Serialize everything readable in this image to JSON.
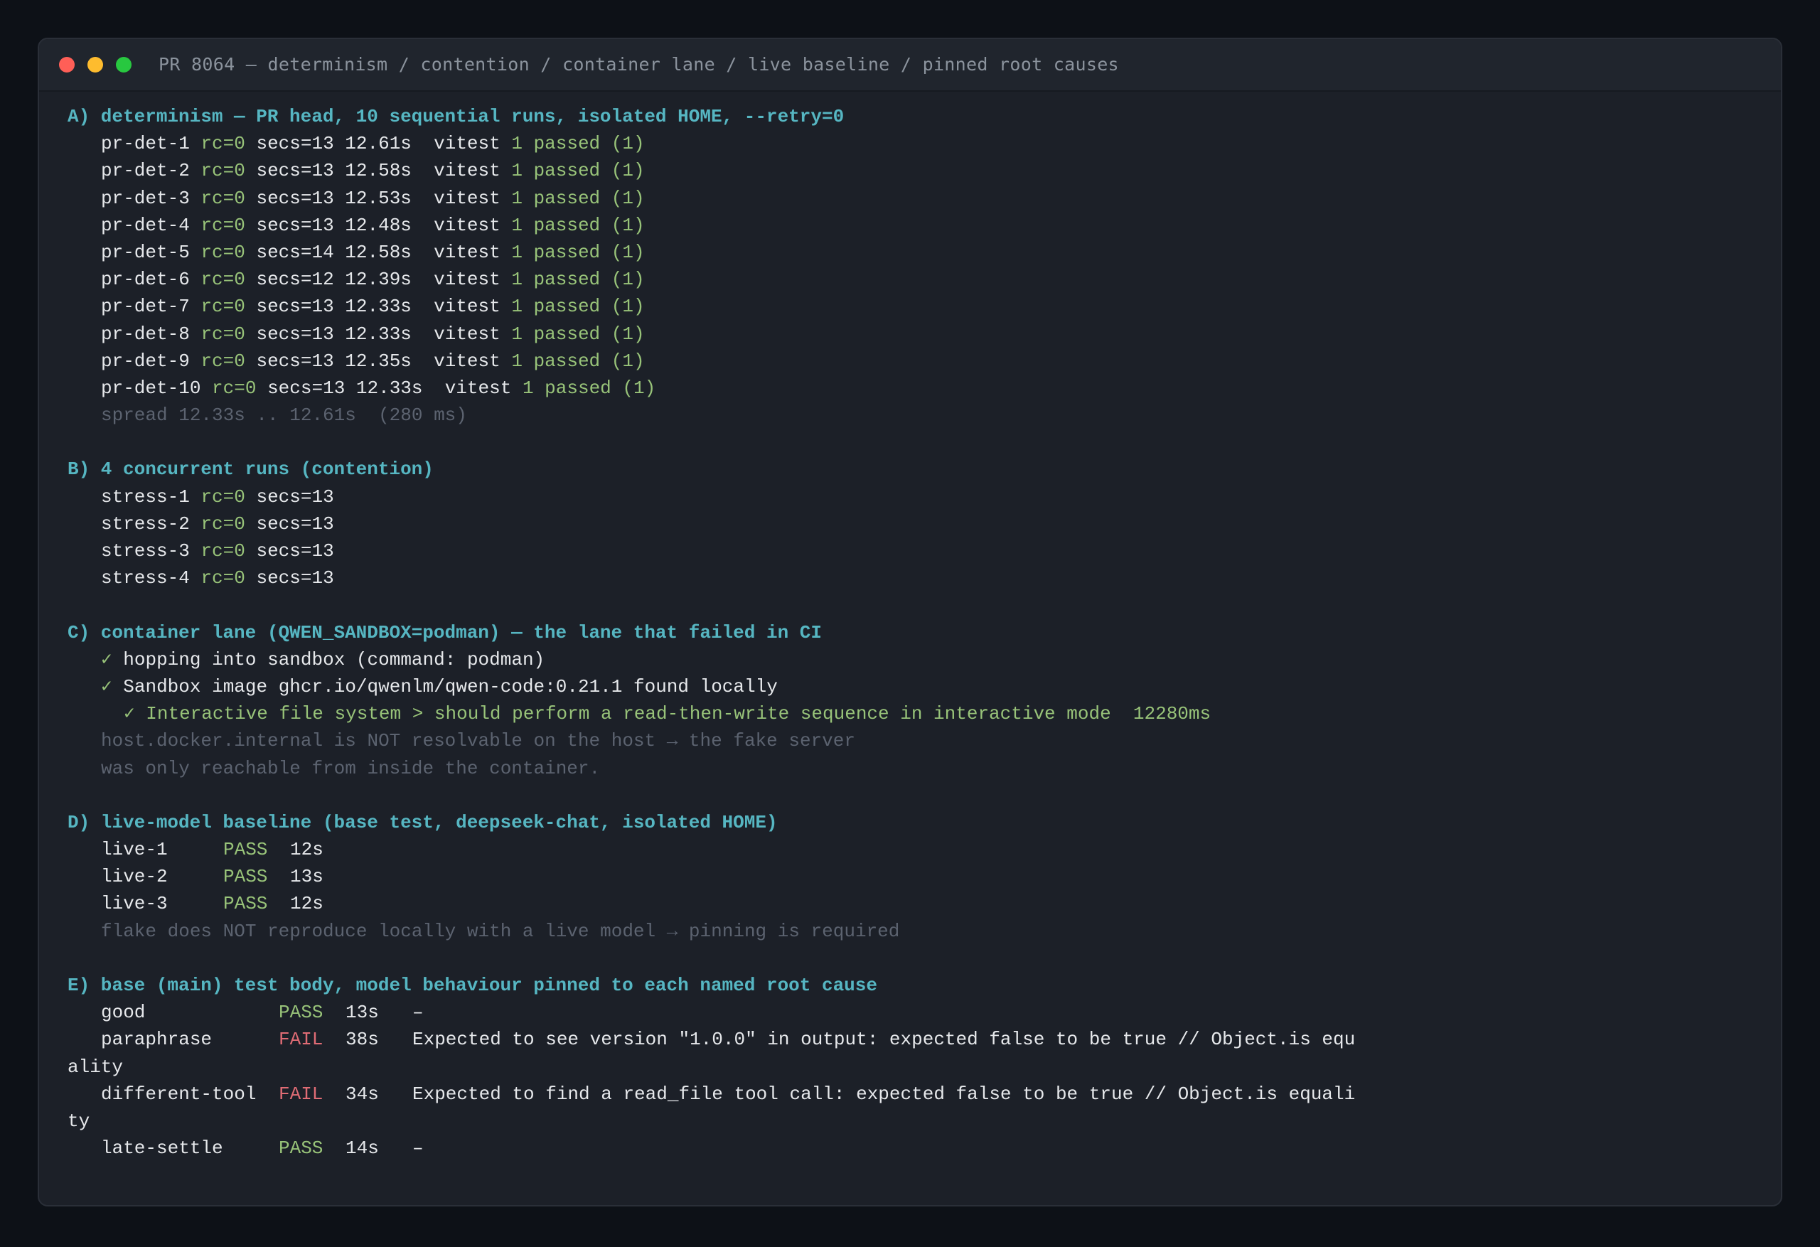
{
  "window": {
    "title": "PR 8064 — determinism / contention / container lane / live baseline / pinned root causes"
  },
  "sections": {
    "a": {
      "header": "A) determinism — PR head, 10 sequential runs, isolated HOME, --retry=0",
      "rows": [
        {
          "name": "pr-det-1",
          "rc": "rc=0",
          "secs": "secs=13 12.61s  vitest",
          "result": "1 passed (1)"
        },
        {
          "name": "pr-det-2",
          "rc": "rc=0",
          "secs": "secs=13 12.58s  vitest",
          "result": "1 passed (1)"
        },
        {
          "name": "pr-det-3",
          "rc": "rc=0",
          "secs": "secs=13 12.53s  vitest",
          "result": "1 passed (1)"
        },
        {
          "name": "pr-det-4",
          "rc": "rc=0",
          "secs": "secs=13 12.48s  vitest",
          "result": "1 passed (1)"
        },
        {
          "name": "pr-det-5",
          "rc": "rc=0",
          "secs": "secs=14 12.58s  vitest",
          "result": "1 passed (1)"
        },
        {
          "name": "pr-det-6",
          "rc": "rc=0",
          "secs": "secs=12 12.39s  vitest",
          "result": "1 passed (1)"
        },
        {
          "name": "pr-det-7",
          "rc": "rc=0",
          "secs": "secs=13 12.33s  vitest",
          "result": "1 passed (1)"
        },
        {
          "name": "pr-det-8",
          "rc": "rc=0",
          "secs": "secs=13 12.33s  vitest",
          "result": "1 passed (1)"
        },
        {
          "name": "pr-det-9",
          "rc": "rc=0",
          "secs": "secs=13 12.35s  vitest",
          "result": "1 passed (1)"
        },
        {
          "name": "pr-det-10",
          "rc": "rc=0",
          "secs": "secs=13 12.33s  vitest",
          "result": "1 passed (1)"
        }
      ],
      "summary": "spread 12.33s .. 12.61s  (280 ms)"
    },
    "b": {
      "header": "B) 4 concurrent runs (contention)",
      "rows": [
        {
          "name": "stress-1",
          "rc": "rc=0",
          "secs": "secs=13"
        },
        {
          "name": "stress-2",
          "rc": "rc=0",
          "secs": "secs=13"
        },
        {
          "name": "stress-3",
          "rc": "rc=0",
          "secs": "secs=13"
        },
        {
          "name": "stress-4",
          "rc": "rc=0",
          "secs": "secs=13"
        }
      ]
    },
    "c": {
      "header": "C) container lane (QWEN_SANDBOX=podman) — the lane that failed in CI",
      "lines": [
        {
          "check": "✓",
          "text": "hopping into sandbox (command: podman)"
        },
        {
          "check": "✓",
          "text": "Sandbox image ghcr.io/qwenlm/qwen-code:0.21.1 found locally"
        }
      ],
      "test_line": "✓ Interactive file system > should perform a read-then-write sequence in interactive mode  12280ms",
      "notes": [
        "host.docker.internal is NOT resolvable on the host → the fake server",
        "was only reachable from inside the container."
      ]
    },
    "d": {
      "header": "D) live-model baseline (base test, deepseek-chat, isolated HOME)",
      "rows": [
        {
          "name": "live-1",
          "status": "PASS",
          "time": "12s"
        },
        {
          "name": "live-2",
          "status": "PASS",
          "time": "13s"
        },
        {
          "name": "live-3",
          "status": "PASS",
          "time": "12s"
        }
      ],
      "note": "flake does NOT reproduce locally with a live model → pinning is required"
    },
    "e": {
      "header": "E) base (main) test body, model behaviour pinned to each named root cause",
      "rows": [
        {
          "name": "good",
          "status": "PASS",
          "time": "13s",
          "message": "–",
          "wrap": ""
        },
        {
          "name": "paraphrase",
          "status": "FAIL",
          "time": "38s",
          "message": "Expected to see version \"1.0.0\" in output: expected false to be true // Object.is equ",
          "wrap": "ality"
        },
        {
          "name": "different-tool",
          "status": "FAIL",
          "time": "34s",
          "message": "Expected to find a read_file tool call: expected false to be true // Object.is equali",
          "wrap": "ty"
        },
        {
          "name": "late-settle",
          "status": "PASS",
          "time": "14s",
          "message": "–",
          "wrap": ""
        }
      ]
    }
  },
  "colors": {
    "header": "#56b6c2",
    "success": "#98c379",
    "failure": "#e06c75",
    "dim": "#5c6370",
    "text": "#e6e8eb",
    "window_bg": "#1c2028",
    "page_bg": "#0d1117"
  }
}
